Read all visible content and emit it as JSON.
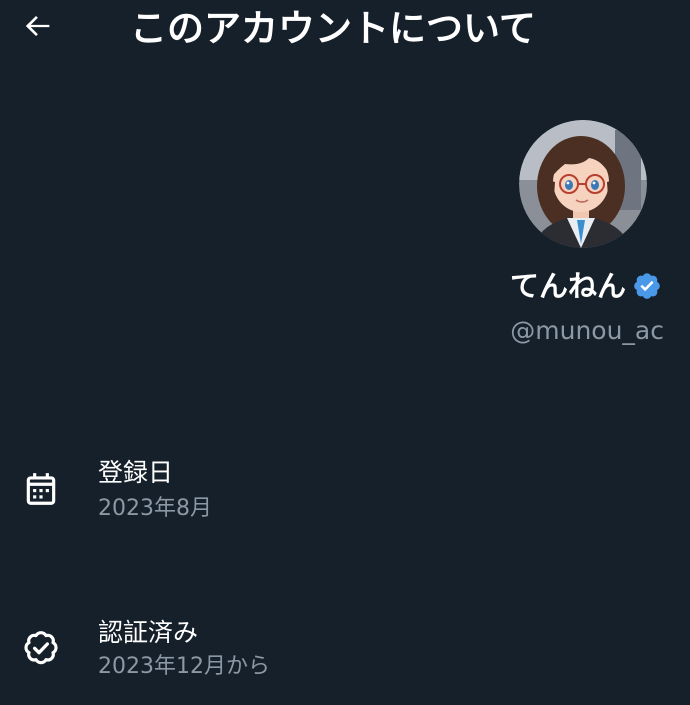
{
  "header": {
    "title": "このアカウントについて",
    "back_icon": "arrow-left-icon"
  },
  "profile": {
    "display_name": "てんねん",
    "handle": "@munou_ac",
    "verified_icon": "verified-badge-icon",
    "verified_color": "#4a99e9",
    "avatar_description": "avatar"
  },
  "info": {
    "joined": {
      "label": "登録日",
      "value": "2023年8月",
      "icon": "calendar-icon"
    },
    "verified": {
      "label": "認証済み",
      "value": "2023年12月から",
      "icon": "verified-check-icon"
    }
  },
  "colors": {
    "background": "#16202a",
    "primary_text": "#ffffff",
    "secondary_text": "#8b98a5",
    "accent": "#4a99e9"
  }
}
